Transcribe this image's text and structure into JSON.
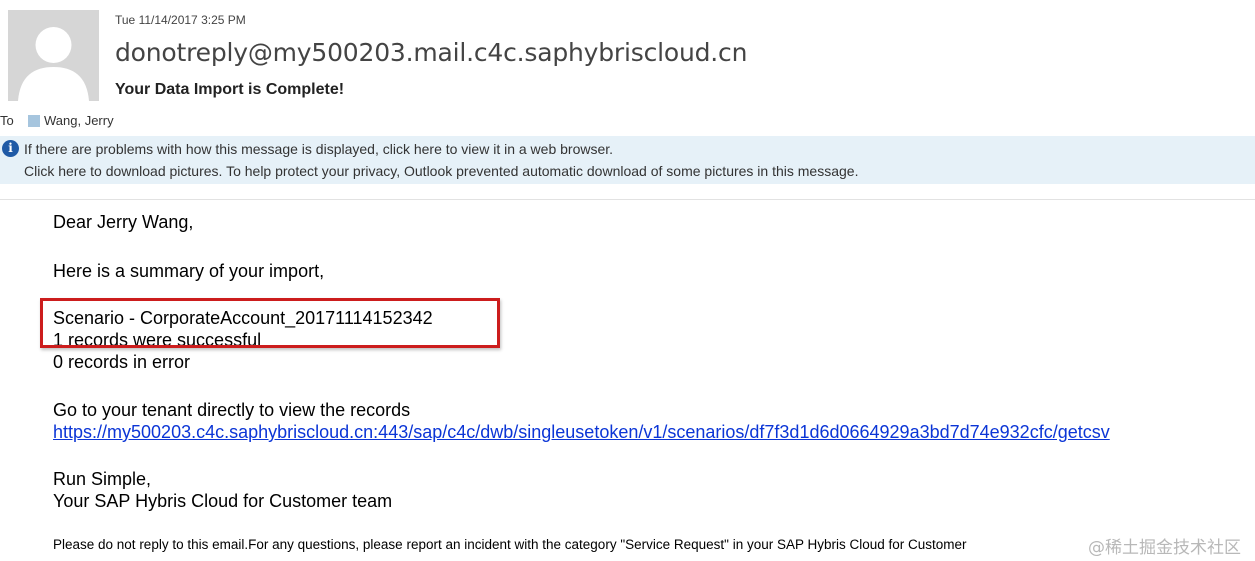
{
  "header": {
    "date": "Tue 11/14/2017 3:25 PM",
    "sender": "donotreply@my500203.mail.c4c.saphybriscloud.cn",
    "subject": "Your Data Import is Complete!",
    "to_label": "To",
    "recipient": "Wang, Jerry",
    "avatar_icon": "person-silhouette-icon",
    "recipient_icon": "contact-square-icon"
  },
  "info_bar": {
    "icon": "info-icon",
    "line1": "If there are problems with how this message is displayed, click here to view it in a web browser.",
    "line2": "Click here to download pictures. To help protect your privacy, Outlook prevented automatic download of some pictures in this message."
  },
  "message": {
    "greeting": "Dear Jerry Wang,",
    "intro": "Here is a summary of your import,",
    "scenario": "Scenario - CorporateAccount_20171114152342",
    "success": "1 records were successful",
    "errors": "0 records in error",
    "goto": "Go to your tenant directly to view the records",
    "link": "https://my500203.c4c.saphybriscloud.cn:443/sap/c4c/dwb/singleusetoken/v1/scenarios/df7f3d1d6d0664929a3bd7d74e932cfc/getcsv",
    "signoff1": "Run Simple,",
    "signoff2": "Your SAP Hybris Cloud for Customer team",
    "footer": "Please do not reply to this email.For any questions, please report an incident with the category \"Service Request\" in your SAP Hybris Cloud for Customer"
  },
  "watermark": "@稀土掘金技术社区",
  "colors": {
    "link": "#0b35d6",
    "highlight_border": "#cc1d1d",
    "info_bar_bg": "#e6f1f8",
    "info_icon": "#1f5aa6"
  }
}
